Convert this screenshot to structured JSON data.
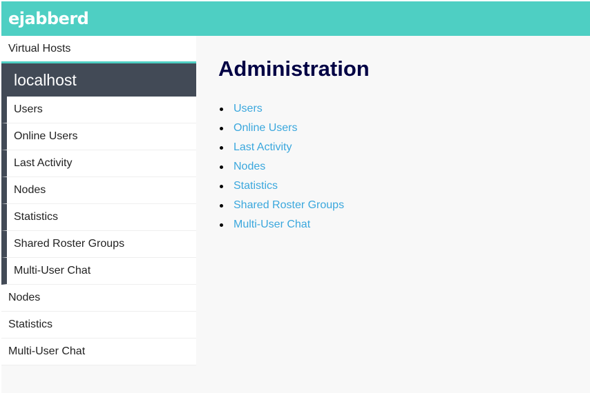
{
  "brand": {
    "logo_text": "ejabberd",
    "accent": "#4ecfc3",
    "dark": "#424a56"
  },
  "sidebar": {
    "virtual_hosts_label": "Virtual Hosts",
    "host_name": "localhost",
    "host_items": [
      {
        "label": "Users"
      },
      {
        "label": "Online Users"
      },
      {
        "label": "Last Activity"
      },
      {
        "label": "Nodes"
      },
      {
        "label": "Statistics"
      },
      {
        "label": "Shared Roster Groups"
      },
      {
        "label": "Multi-User Chat"
      }
    ],
    "global_items": [
      {
        "label": "Nodes"
      },
      {
        "label": "Statistics"
      },
      {
        "label": "Multi-User Chat"
      }
    ]
  },
  "main": {
    "title": "Administration",
    "links": [
      {
        "label": "Users"
      },
      {
        "label": "Online Users"
      },
      {
        "label": "Last Activity"
      },
      {
        "label": "Nodes"
      },
      {
        "label": "Statistics"
      },
      {
        "label": "Shared Roster Groups"
      },
      {
        "label": "Multi-User Chat"
      }
    ]
  }
}
